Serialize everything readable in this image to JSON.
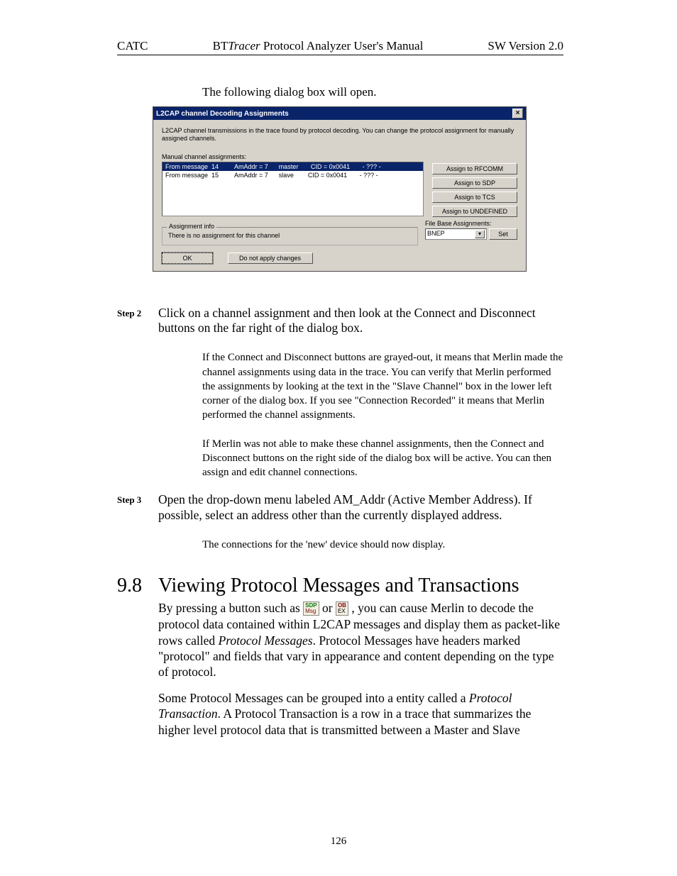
{
  "header": {
    "left": "CATC",
    "center_prefix": "BT",
    "center_italic": "Tracer",
    "center_suffix": " Protocol Analyzer User's Manual",
    "right": "SW Version 2.0"
  },
  "lead_text": "The following dialog box will open.",
  "dialog": {
    "title": "L2CAP channel Decoding Assignments",
    "desc": "L2CAP channel transmissions in the trace found by protocol decoding. You can change the protocol assignment for manually assigned channels.",
    "list_label": "Manual channel assignments:",
    "rows": [
      "From message  14         AmAddr = 7      master       CID = 0x0041       - ??? -",
      "From message  15         AmAddr = 7      slave        CID = 0x0041       - ??? -"
    ],
    "buttons": {
      "rfcomm": "Assign to RFCOMM",
      "sdp": "Assign to SDP",
      "tcs": "Assign to TCS",
      "undef": "Assign to UNDEFINED"
    },
    "fieldset_legend": "Assignment info",
    "fieldset_text": "There is no assignment for this channel",
    "ok": "OK",
    "noapply": "Do not apply changes",
    "filebase_label": "File Base Assignments:",
    "combo_value": "BNEP",
    "set": "Set"
  },
  "step2": {
    "label": "Step 2",
    "text": "Click on a channel assignment and then look at the Connect and Disconnect buttons on the far right of the dialog box."
  },
  "sub1": "If the Connect and Disconnect buttons are grayed-out, it means that Merlin made the channel assignments using data in the trace.  You can verify that Merlin performed the assignments by looking at the text in the \"Slave Channel\" box  in the lower left corner of the dialog box.  If you see \"Connection Recorded\" it means that Merlin performed the channel assignments.",
  "sub2": "If Merlin was not able to make these channel assignments, then the Connect and Disconnect buttons on the right side of the dialog box will be active.  You can then assign and edit channel connections.",
  "step3": {
    "label": "Step 3",
    "text": "Open the drop-down menu labeled AM_Addr (Active Member Address).  If possible, select an address other than the currently displayed address."
  },
  "sub3": "The connections for the 'new' device should now display.",
  "section": {
    "num": "9.8",
    "title": "Viewing Protocol Messages and Transactions"
  },
  "p1a": "By pressing a button such as ",
  "p1b": " or ",
  "p1c": ", you can cause Merlin to ",
  "p1d": "decode the protocol data contained within L2CAP messages and display them as packet-like rows called ",
  "p1_ital": "Protocol Messages",
  "p1e": ".  Protocol Messages have headers marked \"protocol\" and fields that vary in appearance and content depending on the type of protocol.",
  "p2a": "Some Protocol Messages can be grouped into a entity called a ",
  "p2_ital": "Protocol Transaction",
  "p2b": ". A Protocol Transaction is a row in a trace that summarizes the higher level protocol data that is transmitted between a Master and Slave",
  "icons": {
    "sdp_t1": "SDP",
    "sdp_t2": "Msg",
    "ob_t1": "OB",
    "ob_t2": "EX"
  },
  "page_number": "126"
}
